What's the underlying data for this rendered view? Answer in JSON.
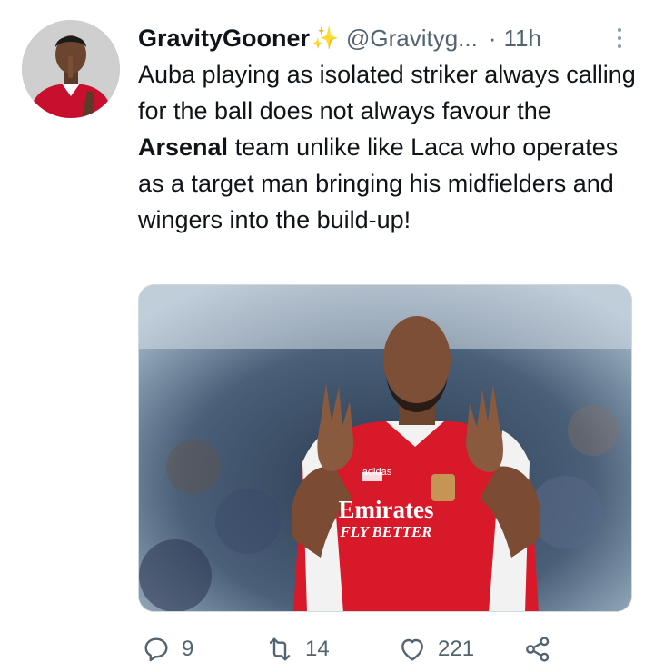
{
  "author": {
    "display_name": "GravityGooner",
    "emoji": "✨",
    "handle": "@Gravityg...",
    "separator": "·",
    "time": "11h"
  },
  "tweet": {
    "text_before": "Auba playing as isolated striker always calling for the ball does not always favour the ",
    "text_bold": "Arsenal",
    "text_after": " team unlike like Laca who operates as a target man bringing his midfielders and wingers into the build-up!"
  },
  "media": {
    "shirt_sponsor": "Emirates",
    "shirt_slogan": "FLY BETTER",
    "shirt_brand": "adidas"
  },
  "actions": {
    "reply_count": "9",
    "retweet_count": "14",
    "like_count": "221"
  },
  "icons": {
    "reply": "reply-icon",
    "retweet": "retweet-icon",
    "like": "heart-icon",
    "share": "share-icon",
    "more": "more-options-icon"
  },
  "colors": {
    "text": "#0f1419",
    "secondary": "#536471",
    "shirt_red": "#d7192a"
  }
}
